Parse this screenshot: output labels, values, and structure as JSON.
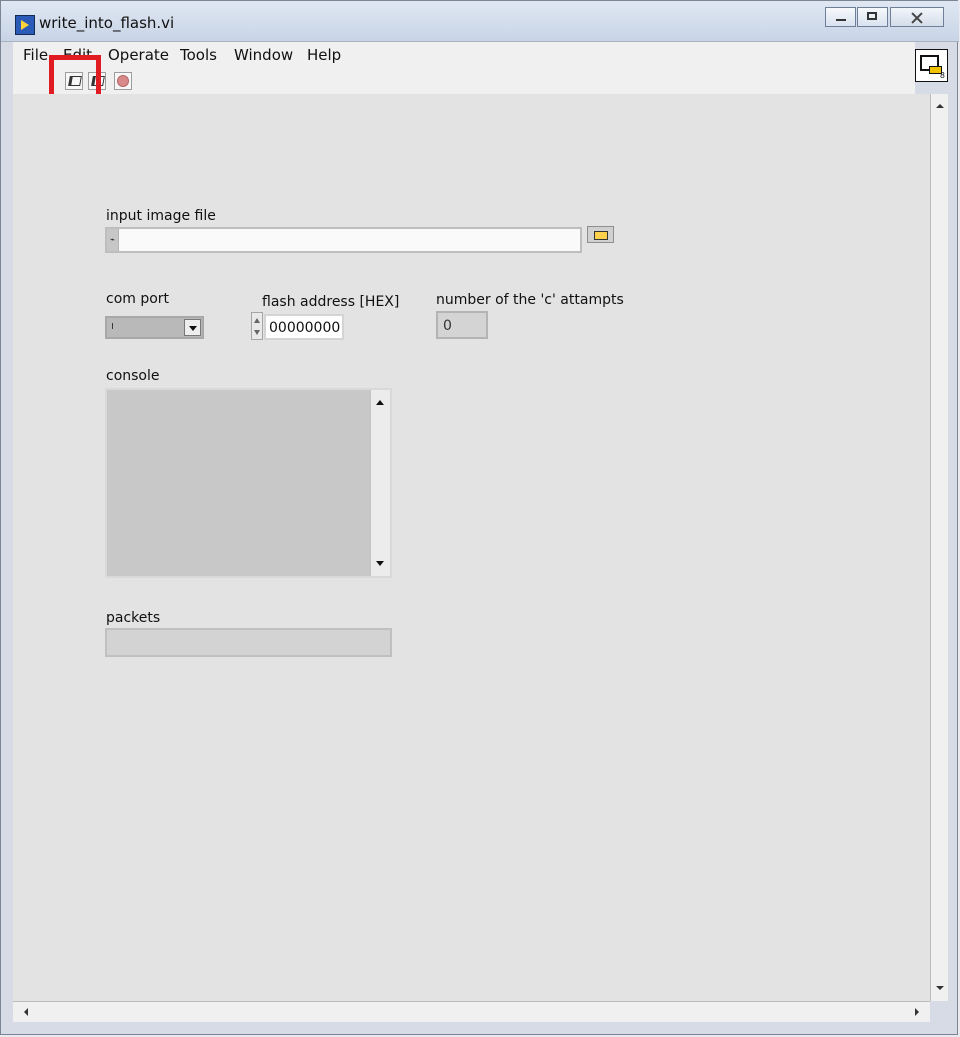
{
  "window": {
    "title": "write_into_flash.vi"
  },
  "menu": {
    "items": [
      "File",
      "Edit",
      "Operate",
      "Tools",
      "Window",
      "Help"
    ]
  },
  "toolbar": {
    "run_icon": "run-arrow-icon",
    "run_continuous_icon": "run-continuous-icon",
    "abort_icon": "abort-stop-icon"
  },
  "controls": {
    "input_image_file": {
      "label": "input image file",
      "value": ""
    },
    "com_port": {
      "label": "com port",
      "value": ""
    },
    "flash_address": {
      "label": "flash address [HEX]",
      "value": "00000000"
    },
    "c_attempts": {
      "label": "number of the 'c' attampts",
      "value": "0"
    },
    "console": {
      "label": "console",
      "value": ""
    },
    "packets": {
      "label": "packets",
      "value": ""
    }
  },
  "colors": {
    "highlight": "#e11b22",
    "panel_background": "#e3e3e3"
  }
}
